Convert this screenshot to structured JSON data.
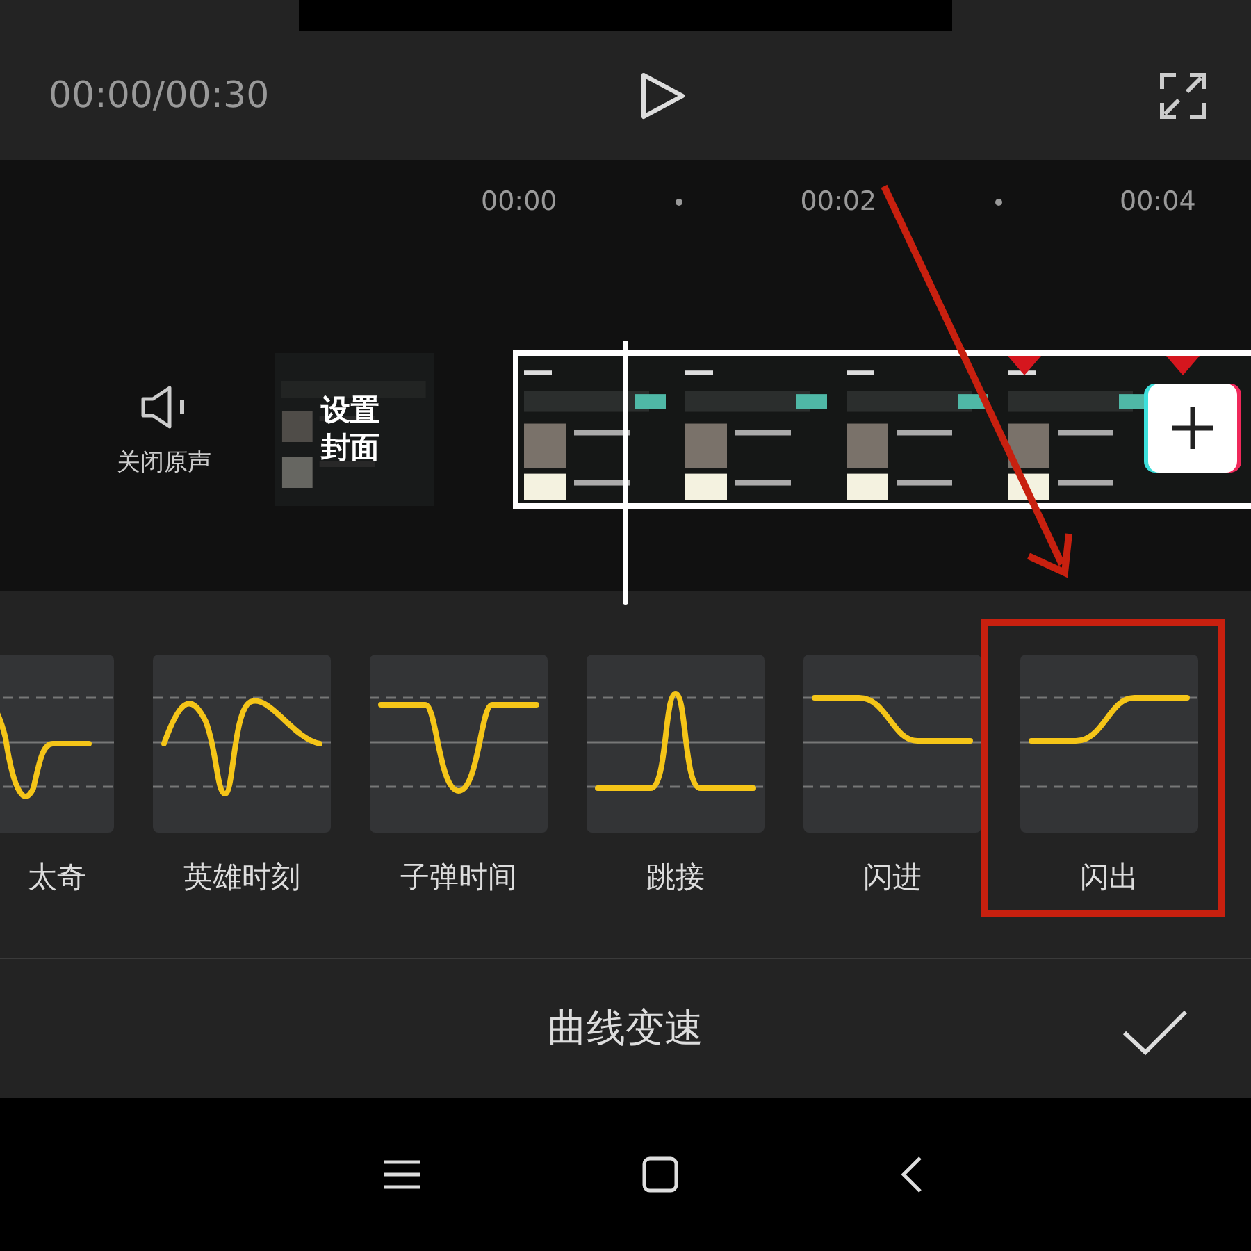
{
  "player": {
    "time": "00:00/00:30"
  },
  "ruler": {
    "ticks": [
      "00:00",
      "00:02",
      "00:04"
    ]
  },
  "track": {
    "mute_label": "关闭原声",
    "cover_label": "设置封面"
  },
  "presets": [
    {
      "label": "太奇",
      "kind": "montage",
      "highlighted": false
    },
    {
      "label": "英雄时刻",
      "kind": "hero",
      "highlighted": false
    },
    {
      "label": "子弹时间",
      "kind": "bullet",
      "highlighted": false
    },
    {
      "label": "跳接",
      "kind": "jump",
      "highlighted": false
    },
    {
      "label": "闪进",
      "kind": "flash_in",
      "highlighted": false
    },
    {
      "label": "闪出",
      "kind": "flash_out",
      "highlighted": true
    }
  ],
  "panel": {
    "title": "曲线变速"
  }
}
